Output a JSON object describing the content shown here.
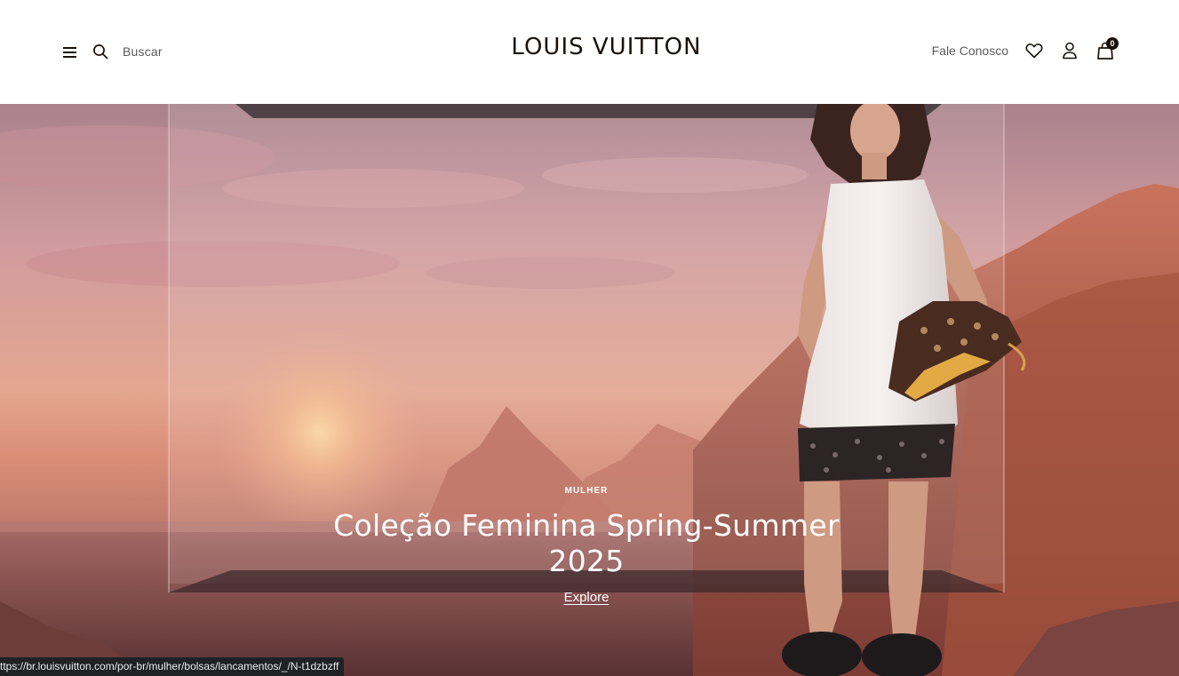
{
  "header": {
    "search_label": "Buscar",
    "brand": "LOUIS VUITTON",
    "contact_label": "Fale Conosco",
    "bag_count": "0"
  },
  "hero": {
    "eyebrow": "MULHER",
    "headline": "Coleção Feminina Spring-Summer 2025",
    "cta_label": "Explore"
  },
  "status_bar": {
    "url": "ttps://br.louisvuitton.com/por-br/mulher/bolsas/lancamentos/_/N-t1dzbzff"
  },
  "colors": {
    "brand_text": "#19110b",
    "nav_text": "#5a5a5a",
    "hero_text": "#ffffff"
  },
  "icons": [
    "menu-icon",
    "search-icon",
    "heart-icon",
    "user-icon",
    "shopping-bag-icon"
  ]
}
